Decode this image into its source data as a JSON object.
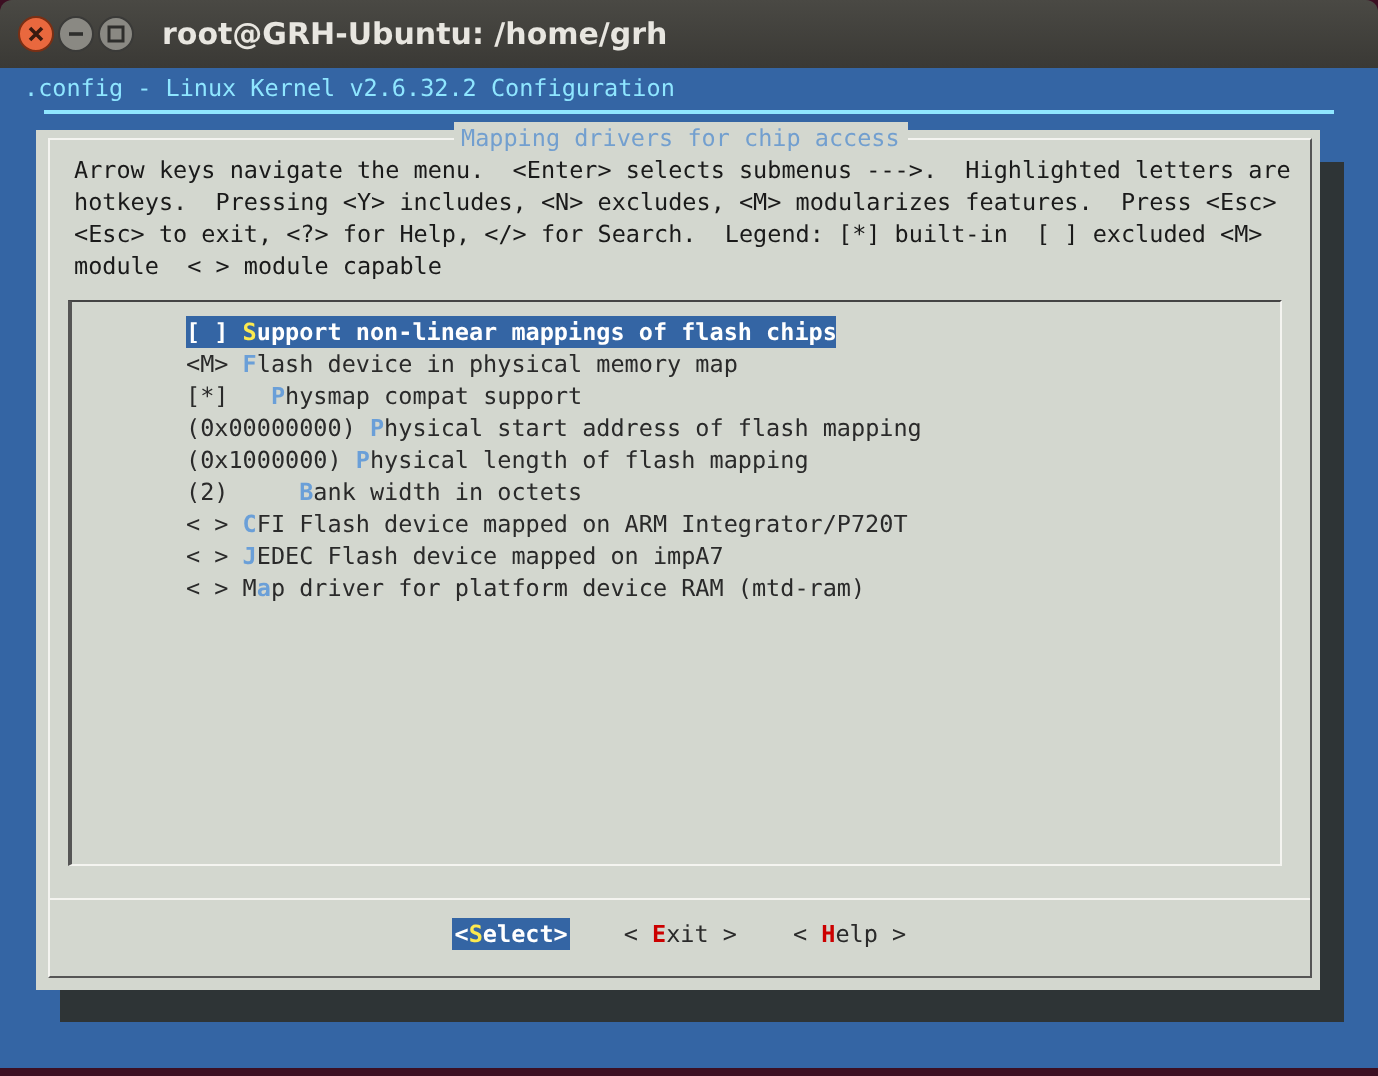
{
  "window": {
    "title": "root@GRH-Ubuntu: /home/grh"
  },
  "header": ".config - Linux Kernel v2.6.32.2 Configuration",
  "dialog": {
    "title": "Mapping drivers for chip access",
    "help": "Arrow keys navigate the menu.  <Enter> selects submenus --->.  Highlighted letters are hotkeys.  Pressing <Y> includes, <N> excludes, <M> modularizes features.  Press <Esc><Esc> to exit, <?> for Help, </> for Search.  Legend: [*] built-in  [ ] excluded <M> module  < > module capable",
    "items": [
      {
        "prefix": "[ ] ",
        "hotkey": "S",
        "rest": "upport non-linear mappings of flash chips",
        "selected": true
      },
      {
        "prefix": "<M> ",
        "hotkey": "F",
        "rest": "lash device in physical memory map",
        "selected": false
      },
      {
        "prefix": "[*]   ",
        "hotkey": "P",
        "rest": "hysmap compat support",
        "selected": false
      },
      {
        "prefix": "(0x00000000) ",
        "hotkey": "P",
        "rest": "hysical start address of flash mapping",
        "selected": false
      },
      {
        "prefix": "(0x1000000) ",
        "hotkey": "P",
        "rest": "hysical length of flash mapping",
        "selected": false
      },
      {
        "prefix": "(2)     ",
        "hotkey": "B",
        "rest": "ank width in octets",
        "selected": false
      },
      {
        "prefix": "< > ",
        "hotkey": "C",
        "rest": "FI Flash device mapped on ARM Integrator/P720T",
        "selected": false
      },
      {
        "prefix": "< > ",
        "hotkey": "J",
        "rest": "EDEC Flash device mapped on impA7",
        "selected": false
      },
      {
        "prefix": "< > M",
        "hotkey": "a",
        "rest": "p driver for platform device RAM (mtd-ram)",
        "selected": false
      }
    ],
    "buttons": [
      {
        "prefix": "<",
        "hotkey": "S",
        "rest": "elect>",
        "selected": true
      },
      {
        "prefix": "< ",
        "hotkey": "E",
        "rest": "xit >",
        "selected": false
      },
      {
        "prefix": "< ",
        "hotkey": "H",
        "rest": "elp >",
        "selected": false
      }
    ]
  }
}
